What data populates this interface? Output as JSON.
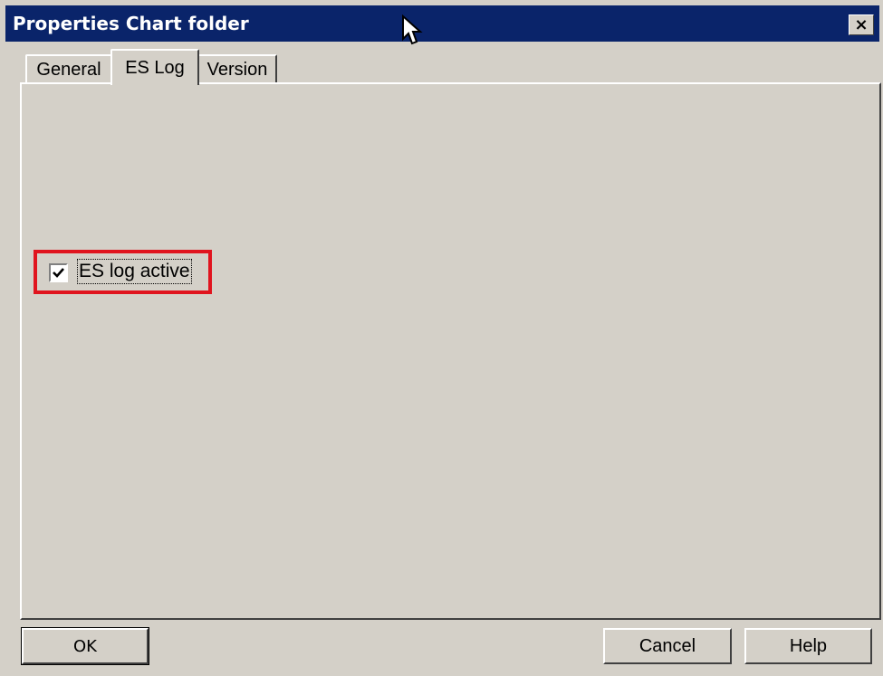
{
  "window": {
    "title": "Properties Chart folder",
    "close_glyph": "×",
    "titlebar_color": "#0a246a"
  },
  "tabs": [
    {
      "label": "General",
      "active": false
    },
    {
      "label": "ES Log",
      "active": true
    },
    {
      "label": "Version",
      "active": false
    }
  ],
  "es_log": {
    "checkbox_label": "ES log active",
    "checked": true,
    "highlight_color": "#e0141e"
  },
  "buttons": {
    "ok_label": "OK",
    "cancel_label": "Cancel",
    "help_label": "Help"
  },
  "icons": {
    "cursor": "arrow-cursor-icon",
    "checkmark": "checkmark-icon"
  }
}
